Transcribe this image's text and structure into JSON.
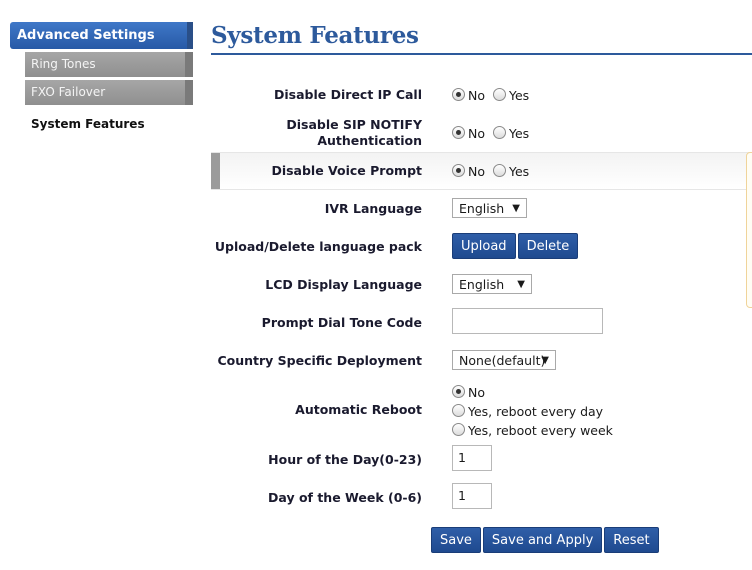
{
  "sidebar": {
    "header": "Advanced Settings",
    "items": [
      {
        "label": "Ring Tones"
      },
      {
        "label": "FXO Failover"
      },
      {
        "label": "System Features"
      }
    ]
  },
  "page": {
    "title": "System Features"
  },
  "form": {
    "disable_direct_ip_call": {
      "label": "Disable Direct IP Call",
      "no": "No",
      "yes": "Yes"
    },
    "disable_sip_notify_auth": {
      "label_line1": "Disable SIP NOTIFY",
      "label_line2": "Authentication",
      "no": "No",
      "yes": "Yes"
    },
    "disable_voice_prompt": {
      "label": "Disable Voice Prompt",
      "no": "No",
      "yes": "Yes"
    },
    "ivr_language": {
      "label": "IVR Language",
      "value": "English"
    },
    "language_pack": {
      "label": "Upload/Delete language pack",
      "upload": "Upload",
      "delete": "Delete"
    },
    "lcd_display_language": {
      "label": "LCD Display Language",
      "value": "English"
    },
    "prompt_dial_tone_code": {
      "label": "Prompt Dial Tone Code",
      "value": ""
    },
    "country_specific_deployment": {
      "label": "Country Specific Deployment",
      "value": "None(default)"
    },
    "automatic_reboot": {
      "label": "Automatic Reboot",
      "options": [
        "No",
        "Yes, reboot every day",
        "Yes, reboot every week"
      ]
    },
    "hour_of_day": {
      "label": "Hour of the Day(0-23)",
      "value": "1"
    },
    "day_of_week": {
      "label": "Day of the Week (0-6)",
      "value": "1"
    }
  },
  "actions": {
    "save": "Save",
    "save_apply": "Save and Apply",
    "reset": "Reset"
  },
  "icons": {
    "dropdown": "chevron-down-icon"
  },
  "colors": {
    "accent": "#2d5a9c",
    "button": "#2f5ea8"
  }
}
